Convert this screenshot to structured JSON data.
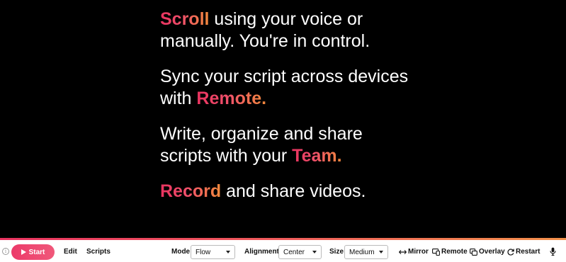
{
  "script": {
    "lines": [
      {
        "highlight": "Scroll",
        "rest": " using your voice or manually. You're in control."
      },
      {
        "lead": "Sync your script across devices with ",
        "highlight": "Remote."
      },
      {
        "lead": "Write, organize and share scripts with your ",
        "highlight": "Team."
      },
      {
        "highlight": "Record",
        "rest": " and share videos."
      }
    ]
  },
  "toolbar": {
    "start_label": "Start",
    "edit_label": "Edit",
    "scripts_label": "Scripts",
    "mode_label": "Mode",
    "mode_value": "Flow",
    "alignment_label": "Alignment",
    "alignment_value": "Center",
    "size_label": "Size",
    "size_value": "Medium",
    "mirror_label": "Mirror",
    "remote_label": "Remote",
    "overlay_label": "Overlay",
    "restart_label": "Restart"
  },
  "icons": {
    "info": "info-icon",
    "play": "play-icon",
    "mirror": "arrows-horizontal-icon",
    "remote": "remote-icon",
    "overlay": "overlay-icon",
    "restart": "restart-icon",
    "mic": "microphone-icon"
  },
  "colors": {
    "accent_start": "#e8325f",
    "accent_end": "#f28a3c",
    "background": "#000000"
  }
}
